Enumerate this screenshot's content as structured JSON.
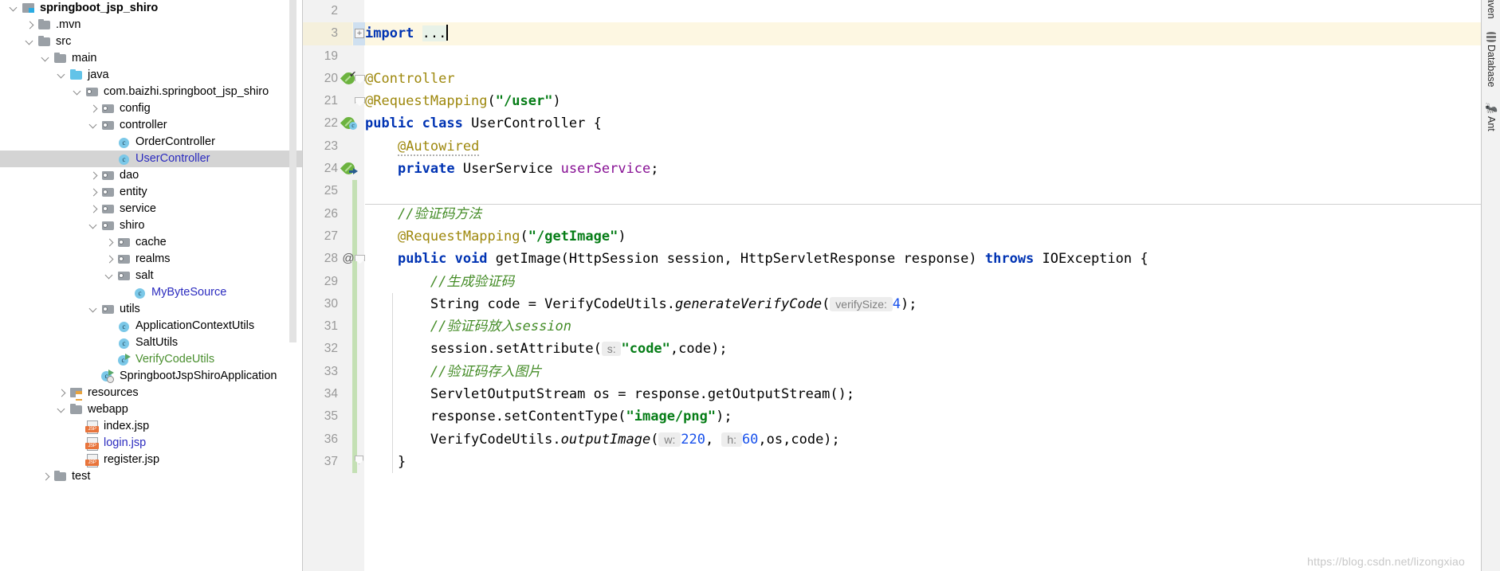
{
  "project_tree": {
    "name": "Project tool window",
    "items": [
      {
        "label": "springboot_jsp_shiro",
        "depth": 0,
        "arrow": "expanded",
        "icon": "module-folder-icon",
        "style": "bold black",
        "selected": false
      },
      {
        "label": ".mvn",
        "depth": 1,
        "arrow": "collapsed",
        "icon": "folder-icon",
        "style": "black",
        "selected": false
      },
      {
        "label": "src",
        "depth": 1,
        "arrow": "expanded",
        "icon": "folder-icon",
        "style": "black",
        "selected": false
      },
      {
        "label": "main",
        "depth": 2,
        "arrow": "expanded",
        "icon": "folder-icon",
        "style": "black",
        "selected": false
      },
      {
        "label": "java",
        "depth": 3,
        "arrow": "expanded",
        "icon": "source-folder-icon",
        "style": "black",
        "selected": false
      },
      {
        "label": "com.baizhi.springboot_jsp_shiro",
        "depth": 4,
        "arrow": "expanded",
        "icon": "package-icon",
        "style": "black",
        "selected": false
      },
      {
        "label": "config",
        "depth": 5,
        "arrow": "collapsed",
        "icon": "package-icon",
        "style": "black",
        "selected": false
      },
      {
        "label": "controller",
        "depth": 5,
        "arrow": "expanded",
        "icon": "package-icon",
        "style": "black",
        "selected": false
      },
      {
        "label": "OrderController",
        "depth": 6,
        "arrow": "none",
        "icon": "java-class-icon",
        "style": "black",
        "selected": false
      },
      {
        "label": "UserController",
        "depth": 6,
        "arrow": "none",
        "icon": "java-class-icon",
        "style": "blue",
        "selected": true
      },
      {
        "label": "dao",
        "depth": 5,
        "arrow": "collapsed",
        "icon": "package-icon",
        "style": "black",
        "selected": false
      },
      {
        "label": "entity",
        "depth": 5,
        "arrow": "collapsed",
        "icon": "package-icon",
        "style": "black",
        "selected": false
      },
      {
        "label": "service",
        "depth": 5,
        "arrow": "collapsed",
        "icon": "package-icon",
        "style": "black",
        "selected": false
      },
      {
        "label": "shiro",
        "depth": 5,
        "arrow": "expanded",
        "icon": "package-icon",
        "style": "black",
        "selected": false
      },
      {
        "label": "cache",
        "depth": 6,
        "arrow": "collapsed",
        "icon": "package-icon",
        "style": "black",
        "selected": false
      },
      {
        "label": "realms",
        "depth": 6,
        "arrow": "collapsed",
        "icon": "package-icon",
        "style": "black",
        "selected": false
      },
      {
        "label": "salt",
        "depth": 6,
        "arrow": "expanded",
        "icon": "package-icon",
        "style": "black",
        "selected": false
      },
      {
        "label": "MyByteSource",
        "depth": 7,
        "arrow": "none",
        "icon": "java-class-icon",
        "style": "blue",
        "selected": false
      },
      {
        "label": "utils",
        "depth": 5,
        "arrow": "expanded",
        "icon": "package-icon",
        "style": "black",
        "selected": false
      },
      {
        "label": "ApplicationContextUtils",
        "depth": 6,
        "arrow": "none",
        "icon": "java-class-icon",
        "style": "black",
        "selected": false
      },
      {
        "label": "SaltUtils",
        "depth": 6,
        "arrow": "none",
        "icon": "java-class-icon",
        "style": "black",
        "selected": false
      },
      {
        "label": "VerifyCodeUtils",
        "depth": 6,
        "arrow": "none",
        "icon": "java-class-runnable-icon",
        "style": "green",
        "selected": false
      },
      {
        "label": "SpringbootJspShiroApplication",
        "depth": 5,
        "arrow": "none",
        "icon": "spring-boot-app-icon",
        "style": "black",
        "selected": false
      },
      {
        "label": "resources",
        "depth": 3,
        "arrow": "collapsed",
        "icon": "resources-folder-icon",
        "style": "black",
        "selected": false
      },
      {
        "label": "webapp",
        "depth": 3,
        "arrow": "expanded",
        "icon": "folder-icon",
        "style": "black",
        "selected": false
      },
      {
        "label": "index.jsp",
        "depth": 4,
        "arrow": "none",
        "icon": "jsp-file-icon",
        "style": "black",
        "selected": false
      },
      {
        "label": "login.jsp",
        "depth": 4,
        "arrow": "none",
        "icon": "jsp-file-icon",
        "style": "blue",
        "selected": false
      },
      {
        "label": "register.jsp",
        "depth": 4,
        "arrow": "none",
        "icon": "jsp-file-icon",
        "style": "black",
        "selected": false
      },
      {
        "label": "test",
        "depth": 2,
        "arrow": "collapsed",
        "icon": "folder-icon",
        "style": "black",
        "selected": false
      }
    ]
  },
  "editor": {
    "name": "UserController.java editor",
    "lines": [
      {
        "no": "2",
        "gutter": "",
        "fold": "",
        "highlight": false,
        "tokens": []
      },
      {
        "no": "3",
        "gutter": "",
        "fold": "plus",
        "highlight": true,
        "tokens": [
          {
            "t": "import ",
            "c": "kw"
          },
          {
            "t": "...",
            "c": "foldimport"
          },
          {
            "t": "",
            "c": "caret"
          }
        ]
      },
      {
        "no": "19",
        "gutter": "",
        "fold": "",
        "highlight": false,
        "tokens": []
      },
      {
        "no": "20",
        "gutter": "spring-bean-check-icon",
        "fold": "minus-top",
        "highlight": false,
        "tokens": [
          {
            "t": "@Controller",
            "c": "ann"
          }
        ]
      },
      {
        "no": "21",
        "gutter": "",
        "fold": "minus-top2",
        "highlight": false,
        "tokens": [
          {
            "t": "@RequestMapping",
            "c": "ann"
          },
          {
            "t": "(",
            "c": "plain"
          },
          {
            "t": "\"/user\"",
            "c": "str"
          },
          {
            "t": ")",
            "c": "plain"
          }
        ]
      },
      {
        "no": "22",
        "gutter": "spring-bean-class-icon",
        "fold": "",
        "highlight": false,
        "tokens": [
          {
            "t": "public class ",
            "c": "kw"
          },
          {
            "t": "UserController {",
            "c": "plain"
          }
        ]
      },
      {
        "no": "23",
        "gutter": "",
        "fold": "",
        "highlight": false,
        "tokens": [
          {
            "t": "    ",
            "c": "plain"
          },
          {
            "t": "@Autowired",
            "c": "ann squig"
          }
        ]
      },
      {
        "no": "24",
        "gutter": "spring-bean-autowire-icon",
        "fold": "",
        "highlight": false,
        "tokens": [
          {
            "t": "    ",
            "c": "plain"
          },
          {
            "t": "private ",
            "c": "kw"
          },
          {
            "t": "UserService ",
            "c": "plain"
          },
          {
            "t": "userService",
            "c": "fld"
          },
          {
            "t": ";",
            "c": "plain"
          }
        ]
      },
      {
        "no": "25",
        "gutter": "",
        "fold": "",
        "highlight": false,
        "tokens": []
      },
      {
        "no": "26",
        "gutter": "",
        "fold": "",
        "highlight": false,
        "tokens": [
          {
            "t": "    ",
            "c": "plain"
          },
          {
            "t": "//验证码方法",
            "c": "cmt"
          }
        ]
      },
      {
        "no": "27",
        "gutter": "",
        "fold": "",
        "highlight": false,
        "tokens": [
          {
            "t": "    ",
            "c": "plain"
          },
          {
            "t": "@RequestMapping",
            "c": "ann"
          },
          {
            "t": "(",
            "c": "plain"
          },
          {
            "t": "\"/getImage\"",
            "c": "str"
          },
          {
            "t": ")",
            "c": "plain"
          }
        ]
      },
      {
        "no": "28",
        "gutter": "at-marker",
        "fold": "minus-top",
        "highlight": false,
        "tokens": [
          {
            "t": "    ",
            "c": "plain"
          },
          {
            "t": "public void ",
            "c": "kw"
          },
          {
            "t": "getImage(HttpSession session, HttpServletResponse response) ",
            "c": "plain"
          },
          {
            "t": "throws ",
            "c": "kw"
          },
          {
            "t": "IOException {",
            "c": "plain"
          }
        ]
      },
      {
        "no": "29",
        "gutter": "",
        "fold": "",
        "highlight": false,
        "tokens": [
          {
            "t": "        ",
            "c": "plain"
          },
          {
            "t": "//生成验证码",
            "c": "cmt"
          }
        ]
      },
      {
        "no": "30",
        "gutter": "",
        "fold": "",
        "highlight": false,
        "tokens": [
          {
            "t": "        String code = VerifyCodeUtils.",
            "c": "plain"
          },
          {
            "t": "generateVerifyCode",
            "c": "mth"
          },
          {
            "t": "(",
            "c": "plain"
          },
          {
            "t": " verifySize: ",
            "c": "hint"
          },
          {
            "t": "4",
            "c": "num"
          },
          {
            "t": ");",
            "c": "plain"
          }
        ]
      },
      {
        "no": "31",
        "gutter": "",
        "fold": "",
        "highlight": false,
        "tokens": [
          {
            "t": "        ",
            "c": "plain"
          },
          {
            "t": "//验证码放入session",
            "c": "cmt"
          }
        ]
      },
      {
        "no": "32",
        "gutter": "",
        "fold": "",
        "highlight": false,
        "tokens": [
          {
            "t": "        session.setAttribute(",
            "c": "plain"
          },
          {
            "t": " s: ",
            "c": "hint"
          },
          {
            "t": "\"code\"",
            "c": "str"
          },
          {
            "t": ",code);",
            "c": "plain"
          }
        ]
      },
      {
        "no": "33",
        "gutter": "",
        "fold": "",
        "highlight": false,
        "tokens": [
          {
            "t": "        ",
            "c": "plain"
          },
          {
            "t": "//验证码存入图片",
            "c": "cmt"
          }
        ]
      },
      {
        "no": "34",
        "gutter": "",
        "fold": "",
        "highlight": false,
        "tokens": [
          {
            "t": "        ServletOutputStream os = response.getOutputStream();",
            "c": "plain"
          }
        ]
      },
      {
        "no": "35",
        "gutter": "",
        "fold": "",
        "highlight": false,
        "tokens": [
          {
            "t": "        response.setContentType(",
            "c": "plain"
          },
          {
            "t": "\"image/png\"",
            "c": "str"
          },
          {
            "t": ");",
            "c": "plain"
          }
        ]
      },
      {
        "no": "36",
        "gutter": "",
        "fold": "",
        "highlight": false,
        "tokens": [
          {
            "t": "        VerifyCodeUtils.",
            "c": "plain"
          },
          {
            "t": "outputImage",
            "c": "mth"
          },
          {
            "t": "(",
            "c": "plain"
          },
          {
            "t": " w: ",
            "c": "hint"
          },
          {
            "t": "220",
            "c": "num"
          },
          {
            "t": ", ",
            "c": "plain"
          },
          {
            "t": " h: ",
            "c": "hint"
          },
          {
            "t": "60",
            "c": "num"
          },
          {
            "t": ",os,code);",
            "c": "plain"
          }
        ]
      },
      {
        "no": "37",
        "gutter": "",
        "fold": "end",
        "highlight": false,
        "tokens": [
          {
            "t": "    }",
            "c": "plain"
          }
        ]
      }
    ]
  },
  "right_tool_window": {
    "name": "right tool window bar",
    "items": [
      {
        "label": "Maven",
        "icon": "maven-icon"
      },
      {
        "label": "Database",
        "icon": "database-icon"
      },
      {
        "label": "Ant",
        "icon": "ant-icon"
      }
    ]
  },
  "watermark": {
    "text": "https://blog.csdn.net/lizongxiao"
  },
  "colors": {
    "keyword": "#0033b3",
    "string": "#067d17",
    "annotation": "#9e880d",
    "comment": "#448c27",
    "number": "#1750eb",
    "field": "#871094",
    "selection": "#d4d4d4",
    "caret_row": "#fdf7e2",
    "gutter_bg": "#f2f2f2",
    "spring_green": "#6cb33f"
  }
}
